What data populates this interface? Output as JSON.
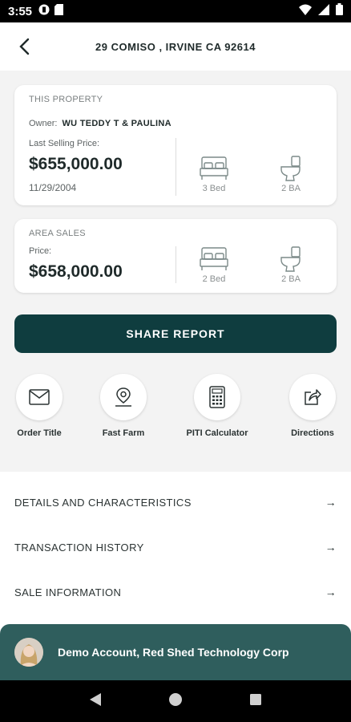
{
  "status_bar": {
    "time": "3:55"
  },
  "header": {
    "title": "29 COMISO , IRVINE CA 92614"
  },
  "this_property": {
    "section_title": "THIS PROPERTY",
    "owner_label": "Owner:",
    "owner_name": "WU TEDDY T & PAULINA",
    "price_label": "Last Selling Price:",
    "price": "$655,000.00",
    "date": "11/29/2004",
    "beds": "3 Bed",
    "baths": "2 BA"
  },
  "area_sales": {
    "section_title": "AREA SALES",
    "price_label": "Price:",
    "price": "$658,000.00",
    "beds": "2 Bed",
    "baths": "2 BA"
  },
  "share_button": "SHARE REPORT",
  "actions": [
    {
      "label": "Order Title",
      "icon": "envelope-icon"
    },
    {
      "label": "Fast Farm",
      "icon": "map-pin-icon"
    },
    {
      "label": "PITI Calculator",
      "icon": "calculator-icon"
    },
    {
      "label": "Directions",
      "icon": "share-arrow-icon"
    }
  ],
  "links": [
    {
      "label": "DETAILS AND CHARACTERISTICS",
      "arrow": "→"
    },
    {
      "label": "TRANSACTION HISTORY",
      "arrow": "→"
    },
    {
      "label": "SALE INFORMATION",
      "arrow": "→"
    }
  ],
  "account": {
    "name": "Demo Account, Red Shed Technology Corp"
  },
  "colors": {
    "primary": "#0f3d3f",
    "account_bar": "#2f5e5d",
    "background": "#f3f3f3"
  }
}
